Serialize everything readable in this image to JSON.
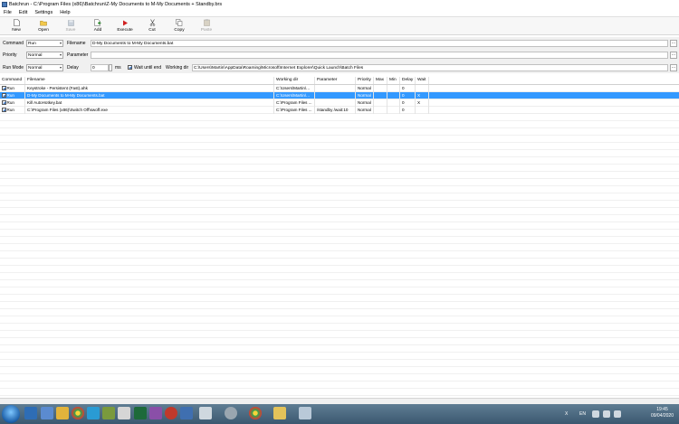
{
  "window": {
    "title": "Batchrun - C:\\Program Files (x86)\\Batchrun\\Z-My Documents to M-My Documents + Standby.brs"
  },
  "menu": [
    "File",
    "Edit",
    "Settings",
    "Help"
  ],
  "toolbar": [
    {
      "label": "New",
      "icon": "new-file-icon",
      "enabled": true
    },
    {
      "label": "Open",
      "icon": "open-folder-icon",
      "enabled": true
    },
    {
      "label": "Save",
      "icon": "save-icon",
      "enabled": false
    },
    {
      "label": "Add",
      "icon": "add-icon",
      "enabled": true
    },
    {
      "label": "Execute",
      "icon": "execute-icon",
      "enabled": true
    },
    {
      "label": "Cut",
      "icon": "cut-icon",
      "enabled": true
    },
    {
      "label": "Copy",
      "icon": "copy-icon",
      "enabled": true
    },
    {
      "label": "Paste",
      "icon": "paste-icon",
      "enabled": false
    }
  ],
  "form": {
    "command_label": "Command",
    "command_value": "Run",
    "filename_label": "Filename",
    "filename_value": "D-My Documents to M-My Documents.bat",
    "priority_label": "Priority",
    "priority_value": "Normal",
    "parameter_label": "Parameter",
    "parameter_value": "",
    "runmode_label": "Run Mode",
    "runmode_value": "Normal",
    "delay_label": "Delay",
    "delay_value": "0",
    "delay_unit": "ms",
    "wait_label": "Wait until end",
    "workdir_label": "Working dir",
    "workdir_value": "C:\\Users\\Martin\\AppData\\Roaming\\Microsoft\\Internet Explorer\\Quick Launch\\Batch Files",
    "browse": "..."
  },
  "grid": {
    "columns": [
      "Command",
      "Filename",
      "Working dir",
      "Parameter",
      "Priority",
      "Max",
      "Min",
      "Delay",
      "Wait"
    ],
    "rows": [
      {
        "checked": true,
        "command": "Run",
        "filename": "Keystroke - Persistent (Fast).ahk",
        "workdir": "C:\\Users\\Martin\\...",
        "parameter": "",
        "priority": "Normal",
        "max": "",
        "min": "",
        "delay": "0",
        "wait": ""
      },
      {
        "checked": true,
        "command": "Run",
        "filename": "D-My Documents to M-My Documents.bat",
        "workdir": "C:\\Users\\Martin\\...",
        "parameter": "",
        "priority": "Normal",
        "max": "",
        "min": "",
        "delay": "0",
        "wait": "X",
        "selected": true
      },
      {
        "checked": true,
        "command": "Run",
        "filename": "Kill AutoHotkey.bat",
        "workdir": "C:\\Program Files ...",
        "parameter": "",
        "priority": "Normal",
        "max": "",
        "min": "",
        "delay": "0",
        "wait": "X"
      },
      {
        "checked": true,
        "command": "Run",
        "filename": "C:\\Program Files (x86)\\Switch Off\\swoff.exe",
        "workdir": "C:\\Program Files ...",
        "parameter": "/standby /wait:10",
        "priority": "Normal",
        "max": "",
        "min": "",
        "delay": "0",
        "wait": ""
      }
    ]
  },
  "taskbar": {
    "tray": [
      "X",
      "EN"
    ],
    "time": "19:45",
    "date": "09/04/2020"
  },
  "colors": {
    "selection": "#3399ff",
    "taskbar": "#4a6880"
  }
}
